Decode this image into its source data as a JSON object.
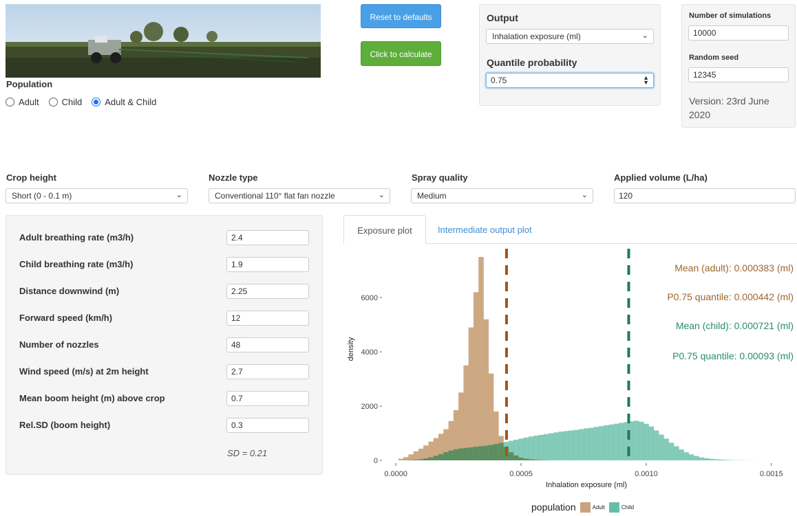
{
  "population": {
    "label": "Population",
    "options": [
      {
        "label": "Adult",
        "selected": false
      },
      {
        "label": "Child",
        "selected": false
      },
      {
        "label": "Adult & Child",
        "selected": true
      }
    ]
  },
  "buttons": {
    "reset": "Reset to defaults",
    "calculate": "Click to calculate"
  },
  "output_panel": {
    "output_label": "Output",
    "output_value": "Inhalation exposure (ml)",
    "quantile_label": "Quantile probability",
    "quantile_value": "0.75"
  },
  "simulation_panel": {
    "nsim_label": "Number of simulations",
    "nsim_value": "10000",
    "seed_label": "Random seed",
    "seed_value": "12345",
    "version_text": "Version: 23rd June 2020"
  },
  "settings": {
    "crop_height": {
      "label": "Crop height",
      "value": "Short (0 - 0.1 m)"
    },
    "nozzle_type": {
      "label": "Nozzle type",
      "value": "Conventional 110° flat fan nozzle"
    },
    "spray_quality": {
      "label": "Spray quality",
      "value": "Medium"
    },
    "applied_volume": {
      "label": "Applied volume (L/ha)",
      "value": "120"
    }
  },
  "parameters": [
    {
      "label": "Adult breathing rate (m3/h)",
      "value": "2.4"
    },
    {
      "label": "Child breathing rate (m3/h)",
      "value": "1.9"
    },
    {
      "label": "Distance downwind (m)",
      "value": "2.25"
    },
    {
      "label": "Forward speed (km/h)",
      "value": "12"
    },
    {
      "label": "Number of nozzles",
      "value": "48"
    },
    {
      "label": "Wind speed (m/s) at 2m height",
      "value": "2.7"
    },
    {
      "label": "Mean boom height (m) above crop",
      "value": "0.7"
    },
    {
      "label": "Rel.SD (boom height)",
      "value": "0.3"
    }
  ],
  "sd_text": "SD = 0.21",
  "tabs": {
    "exposure": "Exposure plot",
    "intermediate": "Intermediate output plot"
  },
  "colors": {
    "adult": "#c9a37c",
    "child": "#66bea8",
    "adult_line": "#a0561a",
    "child_line": "#1e7a5f",
    "overlap": "#5a8a5a"
  },
  "chart_data": {
    "type": "histogram",
    "xlabel": "Inhalation exposure (ml)",
    "ylabel": "density",
    "xlim": [
      -5e-05,
      0.00155
    ],
    "ylim": [
      0,
      7600
    ],
    "x_ticks": [
      {
        "v": 0.0,
        "label": "0.0000"
      },
      {
        "v": 0.0005,
        "label": "0.0005"
      },
      {
        "v": 0.001,
        "label": "0.0010"
      },
      {
        "v": 0.0015,
        "label": "0.0015"
      }
    ],
    "y_ticks": [
      {
        "v": 0,
        "label": "0"
      },
      {
        "v": 2000,
        "label": "2000"
      },
      {
        "v": 4000,
        "label": "4000"
      },
      {
        "v": 6000,
        "label": "6000"
      }
    ],
    "bin_width": 2e-05,
    "bin_start": 1e-05,
    "series": [
      {
        "name": "Adult",
        "values": [
          60,
          120,
          220,
          330,
          430,
          550,
          690,
          820,
          980,
          1150,
          1450,
          1850,
          2500,
          3500,
          4900,
          6200,
          7500,
          5200,
          3200,
          1800,
          900,
          500,
          300,
          180,
          100,
          60,
          35,
          20,
          10,
          5,
          0,
          0,
          0,
          0,
          0,
          0,
          0,
          0,
          0,
          0,
          0,
          0,
          0,
          0,
          0,
          0,
          0,
          0,
          0,
          0,
          0,
          0,
          0,
          0,
          0,
          0,
          0,
          0,
          0,
          0,
          0,
          0,
          0,
          0,
          0,
          0,
          0,
          0,
          0,
          0,
          0,
          0,
          0
        ]
      },
      {
        "name": "Child",
        "values": [
          0,
          5,
          10,
          20,
          40,
          70,
          110,
          170,
          230,
          300,
          360,
          410,
          440,
          460,
          480,
          500,
          520,
          540,
          570,
          600,
          640,
          680,
          720,
          760,
          800,
          840,
          880,
          910,
          940,
          970,
          1000,
          1030,
          1060,
          1080,
          1100,
          1120,
          1150,
          1180,
          1200,
          1230,
          1260,
          1290,
          1320,
          1350,
          1380,
          1410,
          1440,
          1460,
          1420,
          1350,
          1250,
          1100,
          950,
          800,
          650,
          520,
          400,
          300,
          220,
          160,
          110,
          80,
          55,
          40,
          30,
          20,
          12,
          8,
          5,
          3,
          2,
          1,
          0
        ]
      }
    ],
    "vlines": [
      {
        "x": 0.000442,
        "series": "Adult"
      },
      {
        "x": 0.00093,
        "series": "Child"
      }
    ],
    "annotations": [
      {
        "text": "Mean (adult): 0.000383 (ml)",
        "series": "Adult"
      },
      {
        "text": "P0.75 quantile: 0.000442 (ml)",
        "series": "Adult"
      },
      {
        "text": "Mean (child): 0.000721 (ml)",
        "series": "Child"
      },
      {
        "text": "P0.75 quantile: 0.00093 (ml)",
        "series": "Child"
      }
    ],
    "legend": {
      "title": "population",
      "entries": [
        "Adult",
        "Child"
      ],
      "position": "bottom"
    }
  }
}
